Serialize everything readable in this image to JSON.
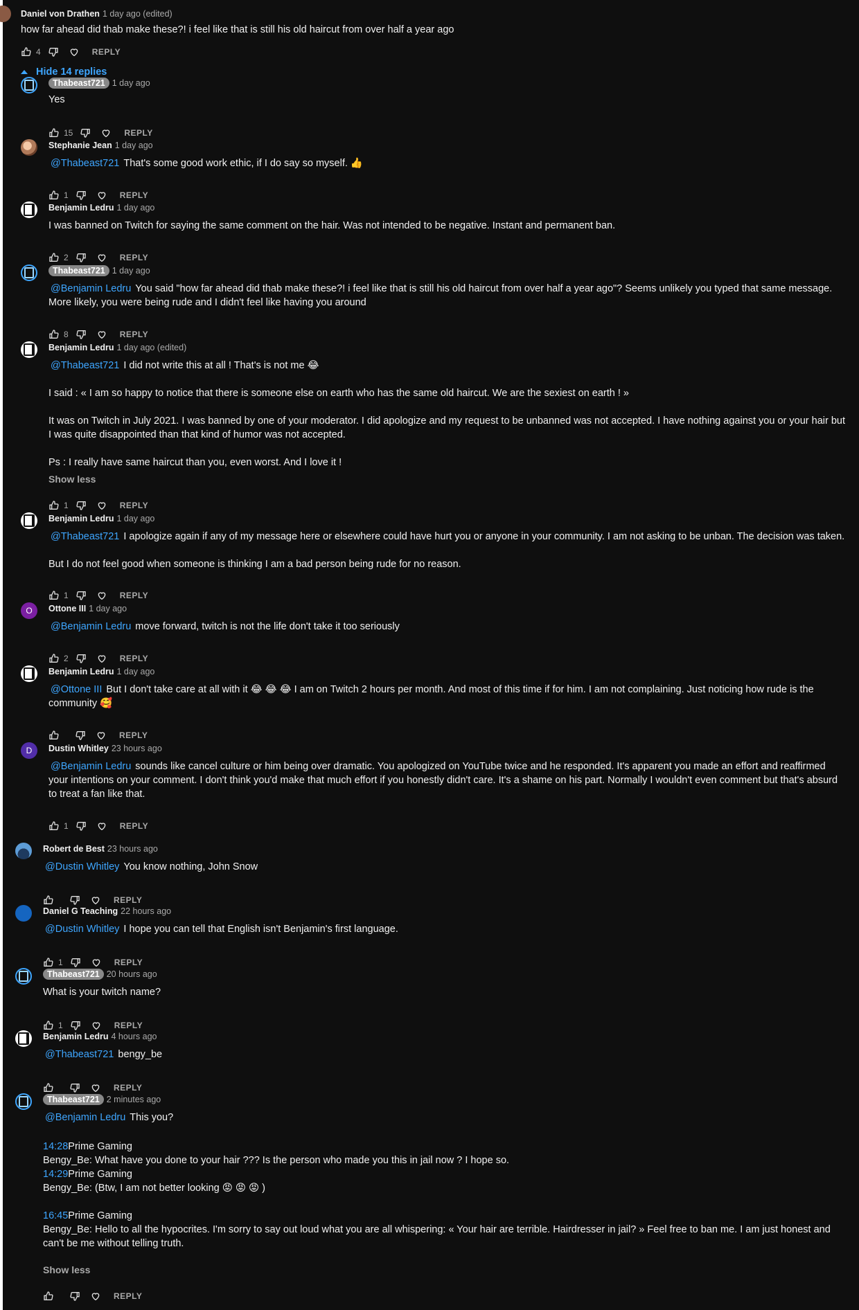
{
  "thread": {
    "author": "Daniel von Drathen",
    "time": "1 day ago (edited)",
    "text": "how far ahead did thab make these?! i feel like that is still his old haircut from over half a year ago",
    "likes": "4",
    "reply_label": "REPLY",
    "hide_replies": "Hide 14 replies"
  },
  "replies": [
    {
      "author": "Thabeast721",
      "time": "1 day ago",
      "lines": [
        "Yes"
      ],
      "likes": "15",
      "reply_label": "REPLY"
    },
    {
      "author": "Stephanie Jean",
      "time": "1 day ago",
      "mention": "@Thabeast721",
      "lines": [
        "That's some good work ethic, if I do say so myself. 👍"
      ],
      "likes": "1",
      "reply_label": "REPLY"
    },
    {
      "author": "Benjamin Ledru",
      "time": "1 day ago",
      "lines": [
        "I was banned on Twitch for saying the same comment on the hair. Was not intended to be negative. Instant and permanent ban."
      ],
      "likes": "2",
      "reply_label": "REPLY"
    },
    {
      "author": "Thabeast721",
      "time": "1 day ago",
      "mention": "@Benjamin Ledru",
      "lines": [
        "You said \"how far ahead did thab make these?! i feel like that is still his old haircut from over half a year ago\"? Seems unlikely you typed that same message.",
        "More likely, you were being rude and I didn't feel like having you around"
      ],
      "likes": "8",
      "reply_label": "REPLY"
    },
    {
      "author": "Benjamin Ledru",
      "time": "1 day ago (edited)",
      "mention": "@Thabeast721",
      "lines": [
        "I did not write this at all ! That's is not me  😂",
        "",
        "I said : « I am so happy to notice that there is someone else on earth who has the same old haircut. We are the sexiest on earth ! »",
        "",
        "It was on Twitch in July 2021. I was banned by one of your moderator. I did apologize and my request to be unbanned was not accepted. I have nothing against you or your hair but",
        "I was quite disappointed than that kind of humor was not accepted.",
        "",
        "Ps : I really have same haircut than you, even worst. And I love it !"
      ],
      "show_less": "Show less",
      "likes": "1",
      "reply_label": "REPLY"
    },
    {
      "author": "Benjamin Ledru",
      "time": "1 day ago",
      "mention": "@Thabeast721",
      "lines": [
        "I apologize again if any of my message here or elsewhere could have hurt you or anyone in your community. I am not asking to be unban. The decision was taken.",
        "",
        "But I do not feel good when someone is thinking I am a bad person being rude for no reason."
      ],
      "likes": "1",
      "reply_label": "REPLY"
    },
    {
      "author": "Ottone III",
      "time": "1 day ago",
      "mention": "@Benjamin Ledru",
      "lines": [
        "move forward, twitch is not the life don't take it too seriously"
      ],
      "likes": "2",
      "reply_label": "REPLY",
      "initial": "O"
    },
    {
      "author": "Benjamin Ledru",
      "time": "1 day ago",
      "mention": "@Ottone III",
      "lines": [
        "But I don't take care at all with it 😂 😂 😂  I am on Twitch 2 hours per month. And most of this time if for him. I am not complaining. Just noticing how rude is the",
        "community 🥰"
      ],
      "likes": "",
      "reply_label": "REPLY"
    },
    {
      "author": "Dustin Whitley",
      "time": "23 hours ago",
      "mention": "@Benjamin Ledru",
      "lines": [
        "sounds like cancel culture or him being over dramatic. You apologized on YouTube twice and he responded. It's apparent you made an effort and reaffirmed",
        "your intentions on your comment. I don't think you'd make that much effort if you honestly didn't care. It's a shame on his part. Normally I wouldn't even comment but that's absurd",
        "to treat a fan like that."
      ],
      "likes": "1",
      "reply_label": "REPLY",
      "initial": "D"
    },
    {
      "author": "Robert de Best",
      "time": "23 hours ago",
      "mention": "@Dustin Whitley",
      "lines": [
        "You know nothing, John Snow"
      ],
      "likes": "",
      "reply_label": "REPLY"
    },
    {
      "author": "Daniel G Teaching",
      "time": "22 hours ago",
      "mention": "@Dustin Whitley",
      "lines": [
        "I hope you can tell that English isn't Benjamin's first language."
      ],
      "likes": "1",
      "reply_label": "REPLY"
    },
    {
      "author": "Thabeast721",
      "time": "20 hours ago",
      "lines": [
        "What is your twitch name?"
      ],
      "likes": "1",
      "reply_label": "REPLY"
    },
    {
      "author": "Benjamin Ledru",
      "time": "4 hours ago",
      "mention": "@Thabeast721",
      "lines": [
        "bengy_be"
      ],
      "likes": "",
      "reply_label": "REPLY"
    },
    {
      "author": "Thabeast721",
      "time": "2 minutes ago",
      "mention": "@Benjamin Ledru",
      "lines": [
        "This you?"
      ],
      "chat": [
        {
          "ts": "",
          "rest": ""
        },
        {
          "ts": "14:28",
          "rest": "Prime Gaming"
        },
        {
          "ts": "",
          "rest": "Bengy_Be: What have you done to your hair ??? Is the person who made you this in jail now ? I hope so."
        },
        {
          "ts": "14:29",
          "rest": "Prime Gaming"
        },
        {
          "ts": "",
          "rest": "Bengy_Be: (Btw, I am not better looking 😡 😡 😡 )"
        },
        {
          "ts": "",
          "rest": ""
        },
        {
          "ts": "16:45",
          "rest": "Prime Gaming"
        },
        {
          "ts": "",
          "rest": "Bengy_Be: Hello to all the hypocrites. I'm sorry to say out loud what you are all whispering: « Your hair are terrible. Hairdresser in jail? » Feel free to ban me. I am just honest and"
        },
        {
          "ts": "",
          "rest": "can't be me without telling truth."
        }
      ],
      "show_less": "Show less",
      "likes": "",
      "reply_label": "REPLY"
    }
  ]
}
